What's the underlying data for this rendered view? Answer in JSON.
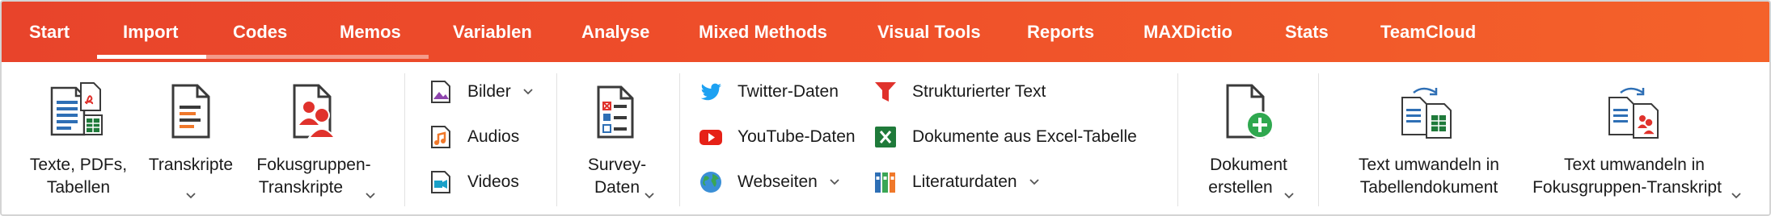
{
  "tabs": [
    {
      "label": "Start"
    },
    {
      "label": "Import"
    },
    {
      "label": "Codes"
    },
    {
      "label": "Memos"
    },
    {
      "label": "Variablen"
    },
    {
      "label": "Analyse"
    },
    {
      "label": "Mixed Methods"
    },
    {
      "label": "Visual Tools"
    },
    {
      "label": "Reports"
    },
    {
      "label": "MAXDictio"
    },
    {
      "label": "Stats"
    },
    {
      "label": "TeamCloud"
    }
  ],
  "active_tab": "Import",
  "ribbon": {
    "texte": {
      "line1": "Texte, PDFs,",
      "line2": "Tabellen"
    },
    "transkripte": {
      "line1": "Transkripte"
    },
    "fokus": {
      "line1": "Fokusgruppen-",
      "line2": "Transkripte"
    },
    "bilder": "Bilder",
    "audios": "Audios",
    "videos": "Videos",
    "survey": {
      "line1": "Survey-",
      "line2": "Daten"
    },
    "twitter": "Twitter-Daten",
    "youtube": "YouTube-Daten",
    "webseiten": "Webseiten",
    "strukturiert": "Strukturierter Text",
    "excel": "Dokumente aus Excel-Tabelle",
    "literatur": "Literaturdaten",
    "dokument": {
      "line1": "Dokument",
      "line2": "erstellen"
    },
    "tabellendok": {
      "line1": "Text umwandeln in",
      "line2": "Tabellendokument"
    },
    "fokustrans": {
      "line1": "Text umwandeln in",
      "line2": "Fokusgruppen-Transkript"
    }
  },
  "colors": {
    "tabbar_start": "#e8442b",
    "tabbar_end": "#f4622a",
    "accent_red": "#e0322c",
    "icon_blue": "#2e6fb5",
    "excel_green": "#1f7a3a",
    "twitter_blue": "#1da1f2",
    "youtube_red": "#e62117",
    "add_green": "#2fa84f"
  }
}
